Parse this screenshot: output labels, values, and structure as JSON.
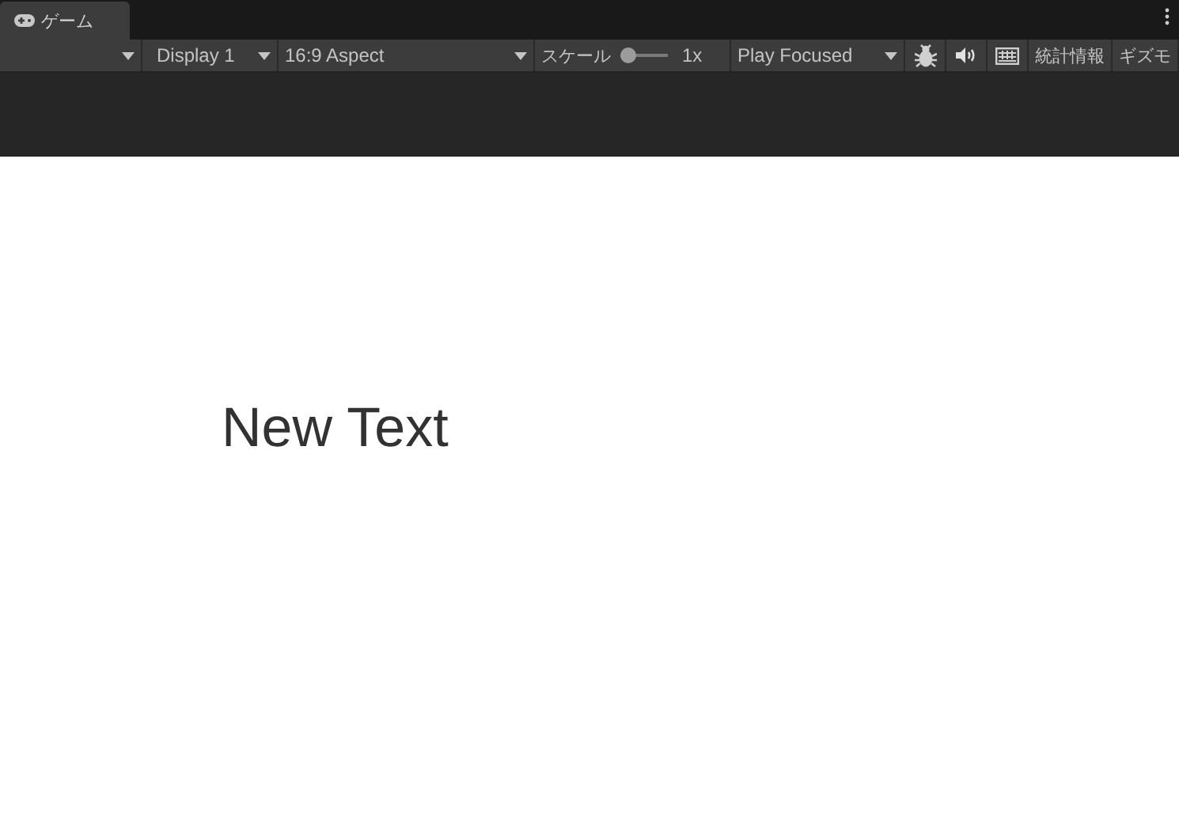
{
  "tab": {
    "label": "ゲーム"
  },
  "toolbar": {
    "display": {
      "label": "Display 1"
    },
    "aspect": {
      "label": "16:9 Aspect"
    },
    "scale": {
      "label": "スケール",
      "level": 0,
      "reading": "1x"
    },
    "play_mode": {
      "label": "Play Focused"
    },
    "buttons": [
      {
        "kind": "bug"
      },
      {
        "kind": "audio"
      },
      {
        "kind": "keyboard"
      },
      {
        "kind": "text",
        "label": "統計情報"
      },
      {
        "kind": "text",
        "label": "ギズモ"
      }
    ]
  },
  "game_view": {
    "text": "New Text"
  }
}
